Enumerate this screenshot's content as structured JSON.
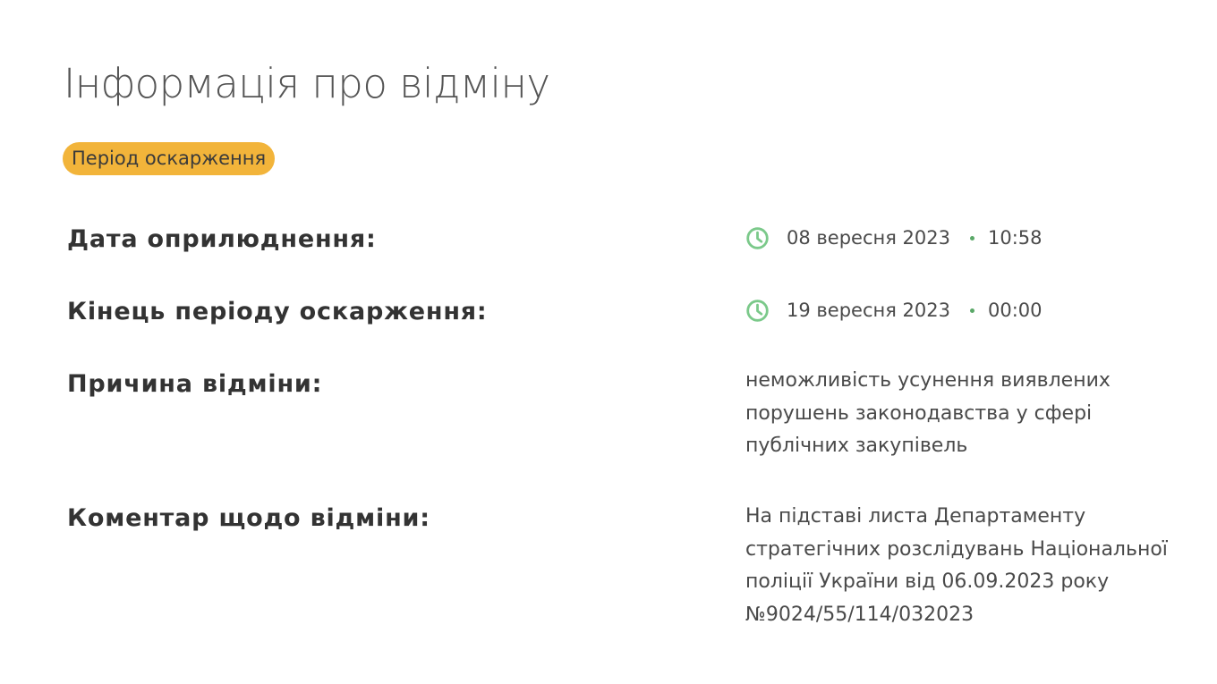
{
  "page": {
    "title": "Інформація про відміну",
    "status_badge": "Період оскарження"
  },
  "colors": {
    "badge_background": "#f2b43a",
    "clock_icon": "#7bc98a",
    "separator_dot": "#5aa868"
  },
  "details": {
    "publication_date": {
      "label": "Дата оприлюднення:",
      "icon": "clock-icon",
      "date": "08 вересня 2023",
      "time": "10:58"
    },
    "appeal_period_end": {
      "label": "Кінець періоду оскарження:",
      "icon": "clock-icon",
      "date": "19 вересня 2023",
      "time": "00:00"
    },
    "cancellation_reason": {
      "label": "Причина відміни:",
      "value": "неможливість усунення виявлених порушень законодавства у сфері публічних закупівель"
    },
    "cancellation_comment": {
      "label": "Коментар щодо відміни:",
      "value": "На підставі листа Департаменту стратегічних розслідувань Національної поліції України від 06.09.2023 року №9024/55/114/032023"
    }
  }
}
